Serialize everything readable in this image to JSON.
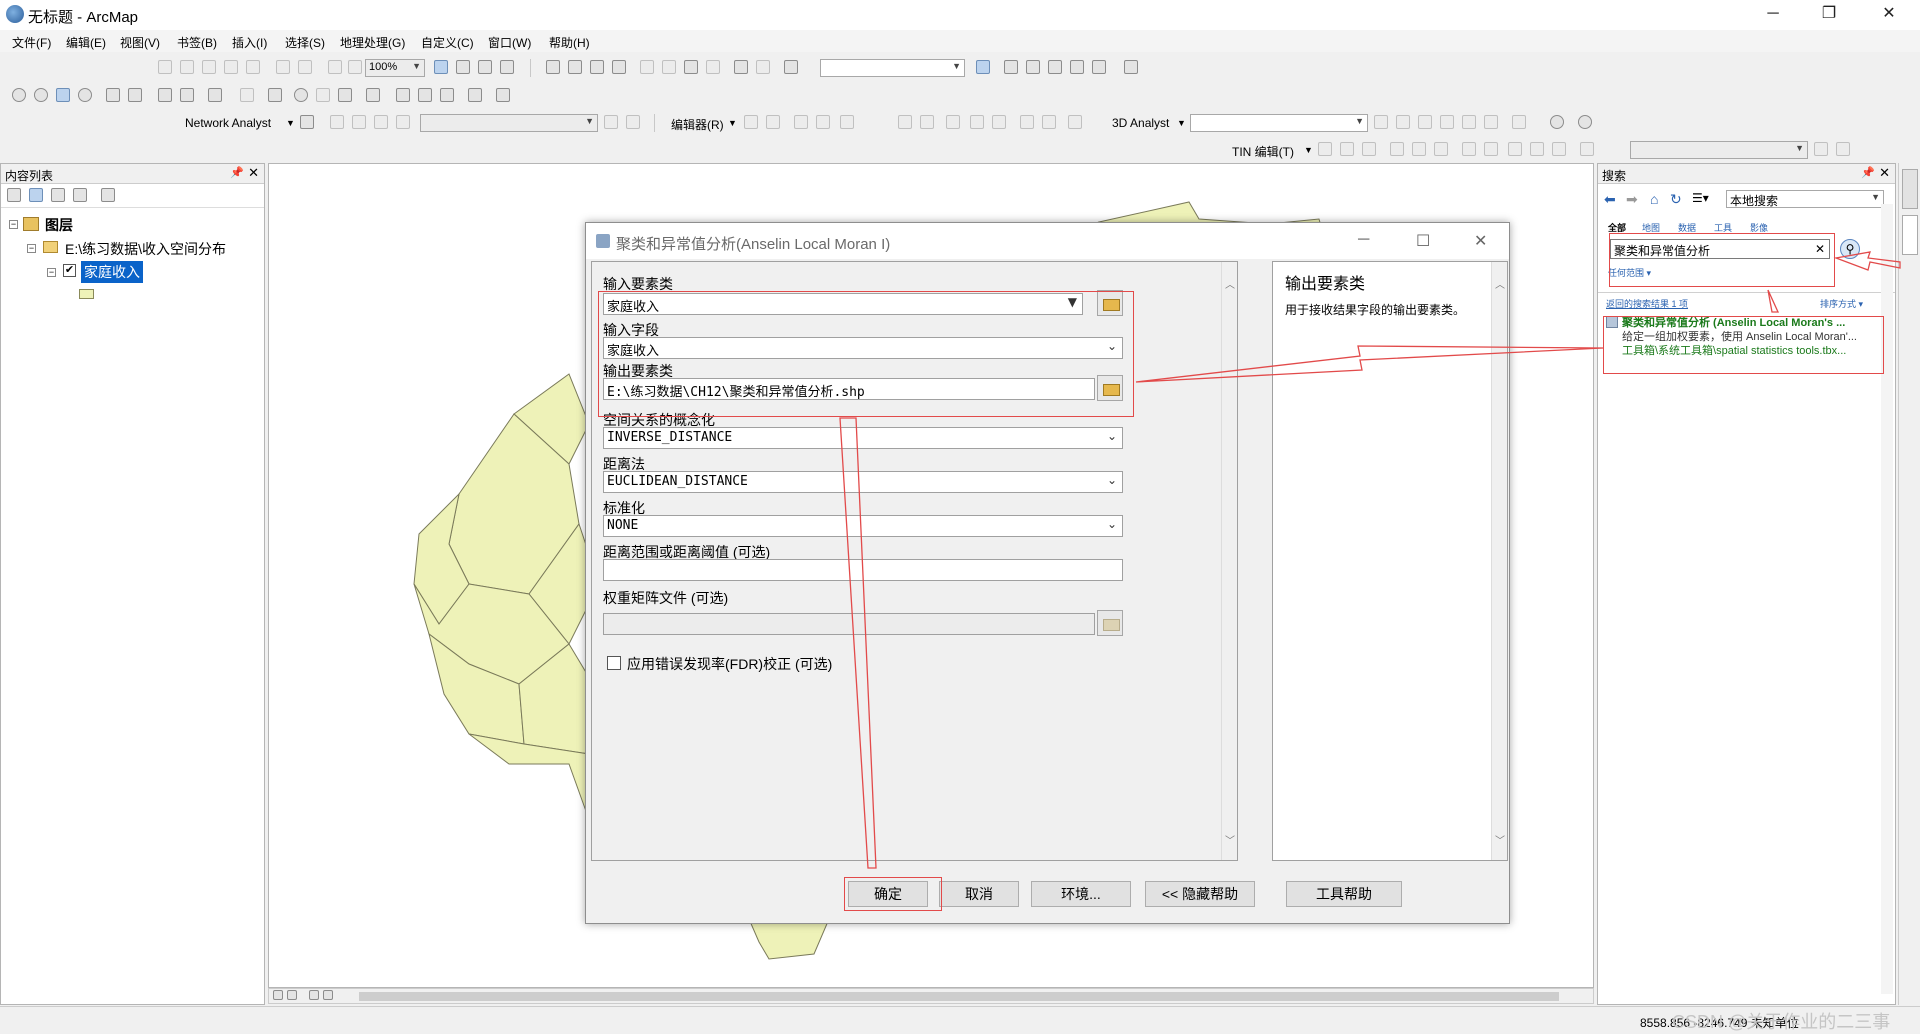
{
  "window": {
    "title": "无标题 - ArcMap"
  },
  "menu": [
    "文件(F)",
    "编辑(E)",
    "视图(V)",
    "书签(B)",
    "插入(I)",
    "选择(S)",
    "地理处理(G)",
    "自定义(C)",
    "窗口(W)",
    "帮助(H)"
  ],
  "toolbar": {
    "zoom": "100%",
    "network_analyst": "Network Analyst",
    "editor": "编辑器(R)",
    "analyst_3d": "3D Analyst",
    "tin_editor": "TIN 编辑(T)"
  },
  "toc": {
    "header": "内容列表",
    "layers_root": "图层",
    "dataframe": "E:\\练习数据\\收入空间分布",
    "layer": "家庭收入"
  },
  "search": {
    "header": "搜索",
    "location": "本地搜索",
    "tabs": [
      "全部",
      "地图",
      "数据",
      "工具",
      "影像"
    ],
    "query": "聚类和异常值分析",
    "scope": "任何范围",
    "result_count": "返回的搜索结果 1 项",
    "sort": "排序方式",
    "result": {
      "title": "聚类和异常值分析 (Anselin Local Moran's ...",
      "desc": "给定一组加权要素，使用 Anselin Local Moran'...",
      "path": "工具箱\\系统工具箱\\spatial statistics tools.tbx..."
    }
  },
  "dialog": {
    "title": "聚类和异常值分析(Anselin Local Moran I)",
    "fields": {
      "input_features_label": "输入要素类",
      "input_features_value": "家庭收入",
      "input_field_label": "输入字段",
      "input_field_value": "家庭收入",
      "output_label": "输出要素类",
      "output_value": "E:\\练习数据\\CH12\\聚类和异常值分析.shp",
      "spatial_label": "空间关系的概念化",
      "spatial_value": "INVERSE_DISTANCE",
      "distance_label": "距离法",
      "distance_value": "EUCLIDEAN_DISTANCE",
      "standard_label": "标准化",
      "standard_value": "NONE",
      "threshold_label": "距离范围或距离阈值 (可选)",
      "threshold_value": "",
      "weights_label": "权重矩阵文件 (可选)",
      "fdr_label": "应用错误发现率(FDR)校正 (可选)"
    },
    "help": {
      "title": "输出要素类",
      "text": "用于接收结果字段的输出要素类。"
    },
    "buttons": {
      "ok": "确定",
      "cancel": "取消",
      "env": "环境...",
      "hide_help": "<< 隐藏帮助",
      "tool_help": "工具帮助"
    }
  },
  "status": {
    "coords": "8558.856  -8246.749 未知单位",
    "watermark": "CSDN @关于作业的二三事"
  }
}
